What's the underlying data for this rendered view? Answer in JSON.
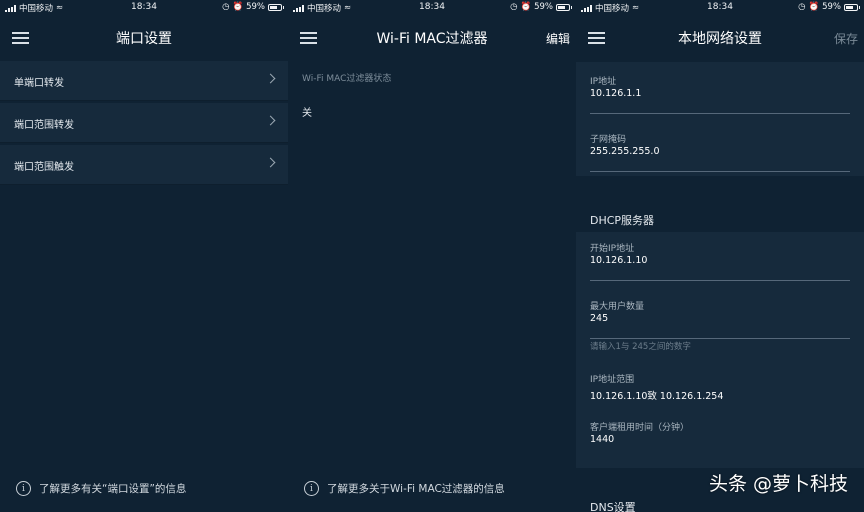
{
  "status_bar": {
    "carrier": "中国移动",
    "time": "18:34",
    "battery": "59%"
  },
  "screen1": {
    "title": "端口设置",
    "items": [
      {
        "label": "单端口转发"
      },
      {
        "label": "端口范围转发"
      },
      {
        "label": "端口范围触发"
      }
    ],
    "footer": "了解更多有关“端口设置”的信息"
  },
  "screen2": {
    "title": "Wi-Fi MAC过滤器",
    "action": "编辑",
    "status_label": "Wi-Fi MAC过滤器状态",
    "status_value": "关",
    "footer": "了解更多关于Wi-Fi MAC过滤器的信息"
  },
  "screen3": {
    "title": "本地网络设置",
    "action": "保存",
    "ip_label": "IP地址",
    "ip_value": "10.126.1.1",
    "mask_label": "子网掩码",
    "mask_value": "255.255.255.0",
    "dhcp_title": "DHCP服务器",
    "start_ip_label": "开始IP地址",
    "start_ip_value": "10.126.1.10",
    "max_users_label": "最大用户数量",
    "max_users_value": "245",
    "max_users_hint": "请输入1与 245之间的数字",
    "range_label": "IP地址范围",
    "range_value": "10.126.1.10致 10.126.1.254",
    "lease_label": "客户端租用时间（分钟）",
    "lease_value": "1440",
    "dns_title": "DNS设置"
  },
  "watermark": "头条 @萝卜科技",
  "colors": {
    "background": "#0f2233",
    "row": "#162a3c",
    "muted_text": "#7d8d9a"
  }
}
